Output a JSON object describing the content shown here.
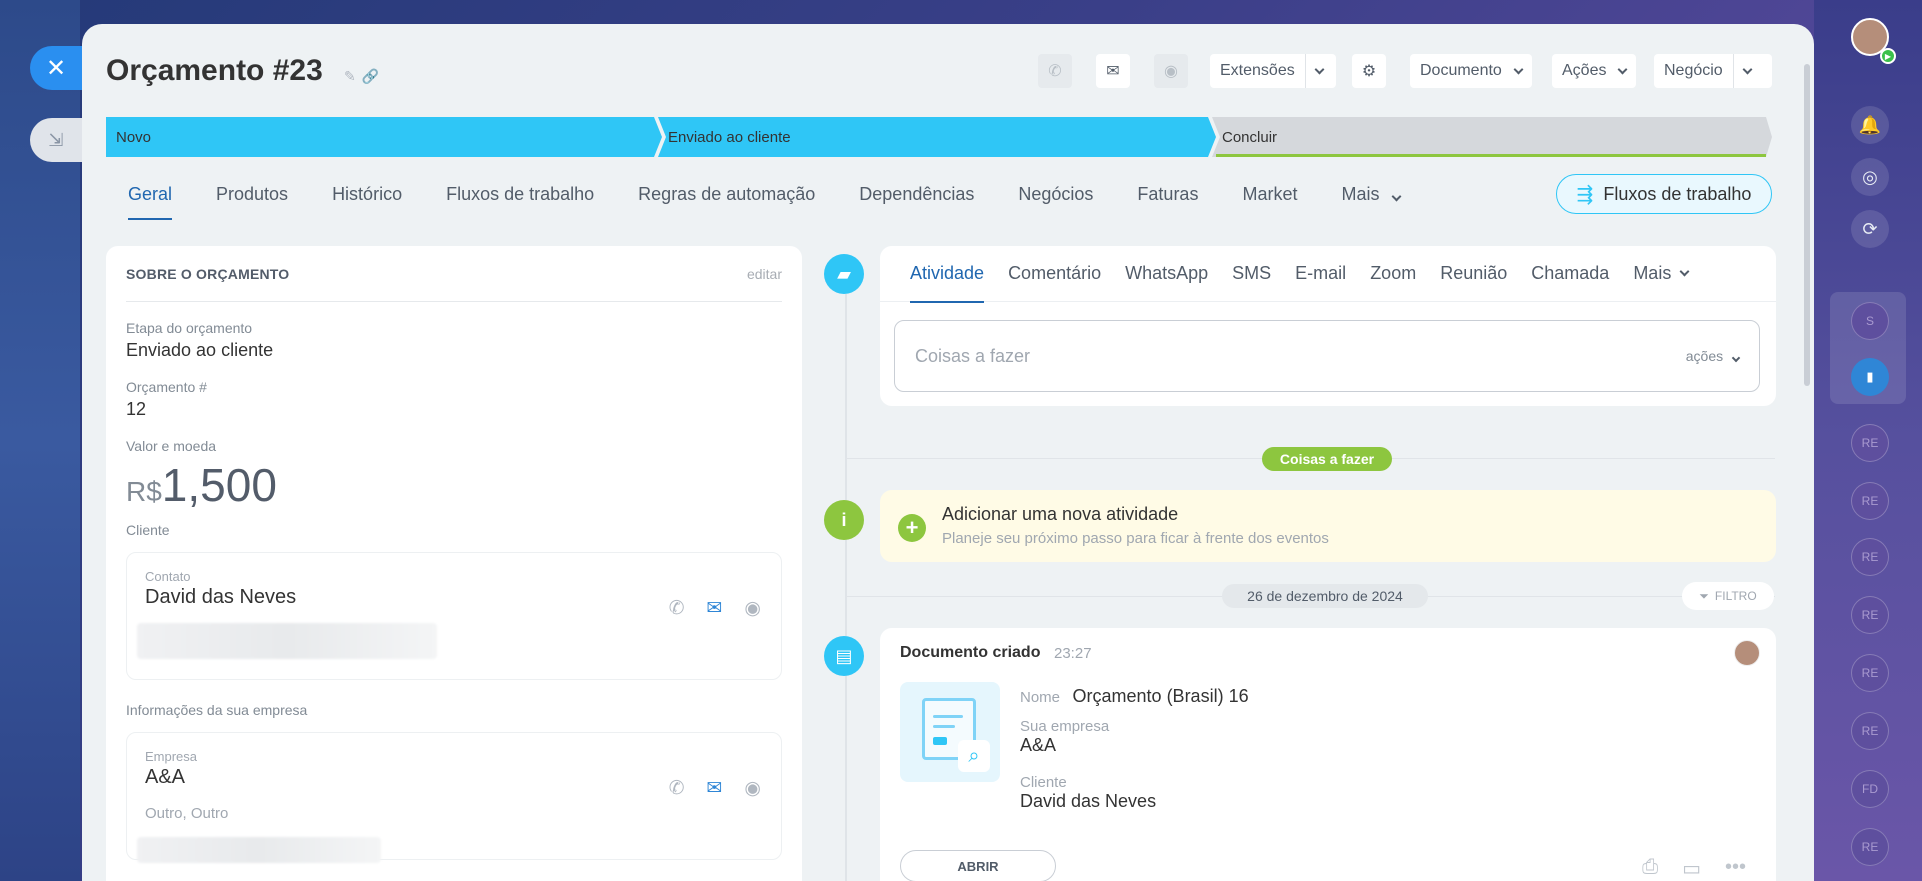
{
  "page": {
    "title": "Orçamento #23"
  },
  "toolbar": {
    "extensoes": "Extensões",
    "documento": "Documento",
    "acoes": "Ações",
    "negocio": "Negócio"
  },
  "stages": [
    {
      "label": "Novo",
      "color": "#2fc6f6"
    },
    {
      "label": "Enviado ao cliente",
      "color": "#2fc6f6"
    },
    {
      "label": "Concluir",
      "color": "#d5d8dc"
    }
  ],
  "tabs": [
    "Geral",
    "Produtos",
    "Histórico",
    "Fluxos de trabalho",
    "Regras de automação",
    "Dependências",
    "Negócios",
    "Faturas",
    "Market",
    "Mais"
  ],
  "flow_button": "Fluxos de trabalho",
  "about": {
    "title": "SOBRE O ORÇAMENTO",
    "edit": "editar",
    "stage_label": "Etapa do orçamento",
    "stage_value": "Enviado ao cliente",
    "number_label": "Orçamento #",
    "number_value": "12",
    "amount_label": "Valor e moeda",
    "currency": "R$",
    "amount": "1,500",
    "client_label": "Cliente",
    "contact_label": "Contato",
    "contact_name": "David das Neves",
    "company_section_label": "Informações da sua empresa",
    "company_label": "Empresa",
    "company_name": "A&A",
    "company_extra": "Outro, Outro"
  },
  "activity": {
    "tabs": [
      "Atividade",
      "Comentário",
      "WhatsApp",
      "SMS",
      "E-mail",
      "Zoom",
      "Reunião",
      "Chamada",
      "Mais"
    ],
    "placeholder": "Coisas a fazer",
    "acoes": "ações",
    "todo_pill": "Coisas a fazer",
    "add_title": "Adicionar uma nova atividade",
    "add_sub": "Planeje seu próximo passo para ficar à frente dos eventos",
    "date_pill": "26 de dezembro de 2024",
    "filter": "FILTRO"
  },
  "doc": {
    "title": "Documento criado",
    "time": "23:27",
    "name_label": "Nome",
    "name_value": "Orçamento (Brasil) 16",
    "company_label": "Sua empresa",
    "company_value": "A&A",
    "client_label": "Cliente",
    "client_value": "David das Neves",
    "open": "ABRIR"
  },
  "rightbar": {
    "items": [
      "S",
      "RE",
      "RE",
      "RE",
      "RE",
      "RE",
      "RE",
      "FD",
      "RE"
    ]
  },
  "colors": {
    "accent": "#2fc6f6",
    "link": "#2067b0",
    "green": "#8dc63f"
  }
}
